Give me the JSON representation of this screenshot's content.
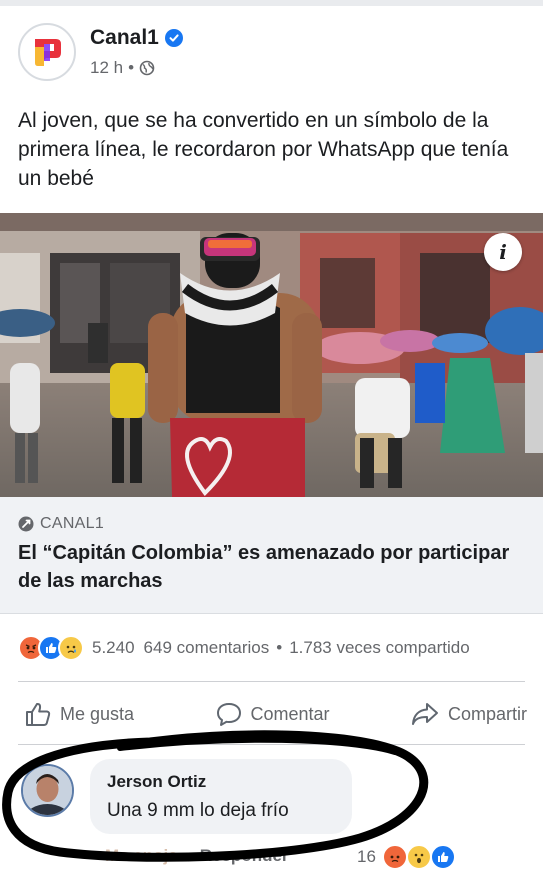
{
  "post": {
    "page_name": "Canal1",
    "time": "12 h",
    "dot": "•",
    "caption": "Al joven, que se ha convertido en un símbolo de la primera línea, le recordaron por WhatsApp que tenía un bebé"
  },
  "link_preview": {
    "source": "CANAL1",
    "headline": "El “Capitán Colombia” es amenazado por participar de las marchas"
  },
  "stats": {
    "reactions_count": "5.240",
    "comments": "649 comentarios",
    "dot": "•",
    "shares": "1.783 veces compartido"
  },
  "actions": {
    "like": "Me gusta",
    "comment": "Comentar",
    "share": "Compartir"
  },
  "comment": {
    "author": "Jerson Ortiz",
    "text": "Una 9 mm lo deja frío",
    "like_action": "Me enoja",
    "reply_action": "Responder",
    "reaction_count": "16"
  },
  "colors": {
    "facebook_blue": "#1877f2",
    "angry": "#f0663a",
    "sad": "#f7c948",
    "annotation": "#000000"
  },
  "icons": {
    "verified": "verified-check-icon",
    "globe": "globe-icon",
    "info": "info-icon",
    "like": "thumbs-up-icon",
    "comment": "speech-bubble-icon",
    "share": "share-arrow-icon"
  }
}
